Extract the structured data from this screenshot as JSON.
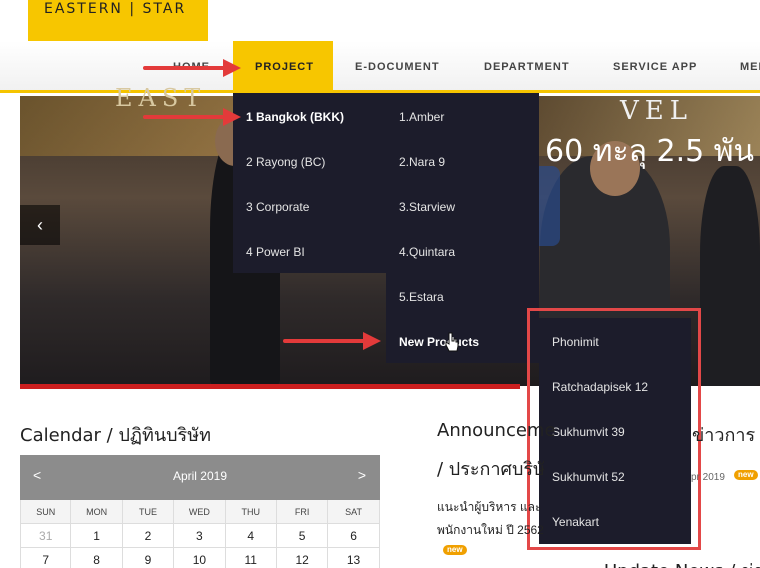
{
  "logo": {
    "text": "EASTERN | STAR"
  },
  "nav": {
    "items": [
      "HOME",
      "PROJECT",
      "E-DOCUMENT",
      "DEPARTMENT",
      "SERVICE APP",
      "MEN"
    ],
    "active": "PROJECT",
    "accent": "#f7c600"
  },
  "hero": {
    "headline": "60 ทะลุ 2.5 พัน",
    "sign_left": "EAST",
    "sign_right": "VEL",
    "prev_icon": "chevron-left-icon"
  },
  "dropdown": {
    "col1": [
      "1 Bangkok (BKK)",
      "2 Rayong (BC)",
      "3 Corporate",
      "4 Power BI"
    ],
    "col2": [
      "1.Amber",
      "2.Nara 9",
      "3.Starview",
      "4.Quintara",
      "5.Estara",
      "New Products"
    ],
    "background": "#1c1c2b"
  },
  "submenu": {
    "items": [
      "Phonimit",
      "Ratchadapisek 12",
      "Sukhumvit 39",
      "Sukhumvit 52",
      "Yenakart"
    ],
    "highlight_color": "#e34848"
  },
  "calendar": {
    "title": "Calendar / ปฏิทินบริษัท",
    "month": "April 2019",
    "prev": "<",
    "next": ">",
    "days": [
      "SUN",
      "MON",
      "TUE",
      "WED",
      "THU",
      "FRI",
      "SAT"
    ],
    "rows": [
      [
        "31",
        "1",
        "2",
        "3",
        "4",
        "5",
        "6"
      ],
      [
        "7",
        "8",
        "9",
        "10",
        "11",
        "12",
        "13"
      ]
    ]
  },
  "announcements": {
    "title": "Announceme",
    "title_right": "ข่าวการ",
    "subtitle": "/ ประกาศบริษั",
    "line1": "แนะนำผู้บริหาร และ",
    "line2": "พนักงานใหม่ ปี 2562",
    "date": "pr 2019",
    "badge": "new"
  },
  "update_news": {
    "title": "Update News / ข่าว"
  }
}
